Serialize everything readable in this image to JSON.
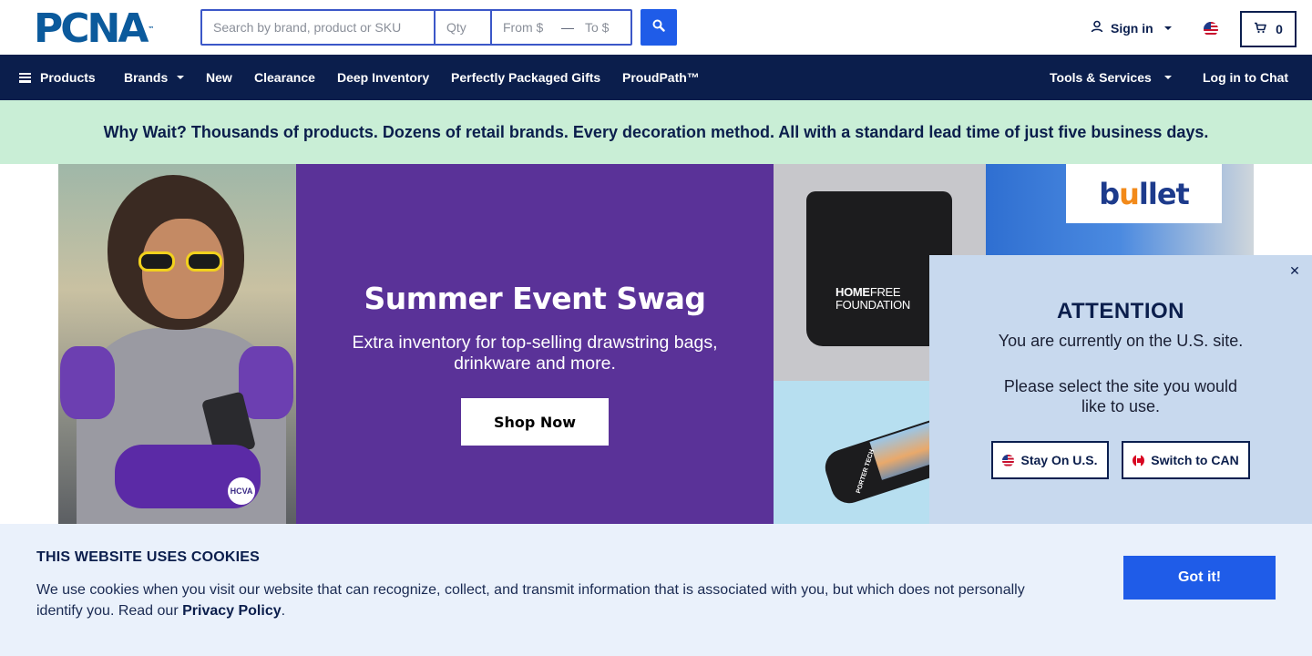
{
  "header": {
    "logo_text": "PCNA",
    "logo_tm": "™",
    "search": {
      "main_placeholder": "Search by brand, product or SKU",
      "qty_placeholder": "Qty",
      "from_placeholder": "From $",
      "dash": "—",
      "to_placeholder": "To $"
    },
    "sign_in_label": "Sign in",
    "cart_count": "0"
  },
  "nav": {
    "products": "Products",
    "brands": "Brands",
    "new": "New",
    "clearance": "Clearance",
    "deep_inventory": "Deep Inventory",
    "gifts": "Perfectly Packaged Gifts",
    "proudpath": "ProudPath™",
    "tools": "Tools & Services",
    "chat": "Log in to Chat"
  },
  "promo": {
    "text": "Why Wait? Thousands of products. Dozens of retail brands. Every decoration method. All with a standard lead time of just five business days."
  },
  "hero": {
    "title": "Summer Event Swag",
    "subtitle": "Extra inventory for top-selling drawstring bags, drinkware and more.",
    "cta": "Shop Now",
    "pack_badge": "HCVA",
    "bag_label_bold": "HOME",
    "bag_label_light": "FREE",
    "bag_label_line2": "FOUNDATION",
    "tool_text": "PORTER TECH",
    "bullet_logo_pre": "b",
    "bullet_logo_u": "u",
    "bullet_logo_post": "llet"
  },
  "attention": {
    "title": "ATTENTION",
    "line1": "You are currently on the U.S. site.",
    "line2": "Please select the site you would like to use.",
    "stay_label": "Stay On U.S.",
    "switch_label": "Switch to CAN",
    "close_glyph": "✕"
  },
  "cookie": {
    "title": "THIS WEBSITE USES COOKIES",
    "text": "We use cookies when you visit our website that can recognize, collect, and transmit information that is associated with you, but which does not personally identify you. Read our ",
    "link": "Privacy Policy",
    "end": ".",
    "button": "Got it!"
  },
  "colors": {
    "nav_bg": "#0b1e4c",
    "accent_blue": "#1f5ce8",
    "promo_bg": "#c9eed6",
    "hero_purple": "#5a3298",
    "popup_bg": "#c8d9ee",
    "cookie_bg": "#eaf1fb"
  },
  "icons": [
    "search-icon",
    "user-icon",
    "caret-down-icon",
    "us-flag-icon",
    "cart-icon",
    "hamburger-icon",
    "close-icon",
    "canada-flag-icon"
  ]
}
